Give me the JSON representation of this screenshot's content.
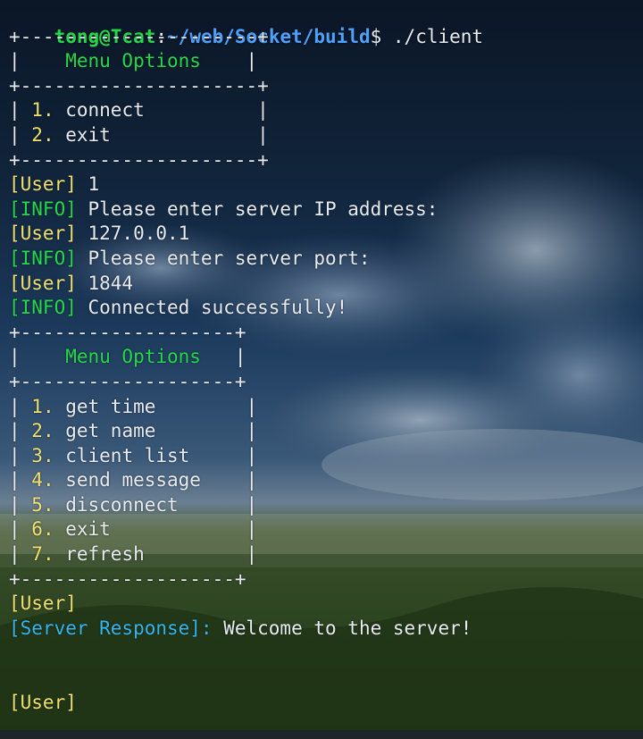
{
  "prompt": {
    "user_host": "tong@Tcat",
    "separator": ":",
    "path": "~/web/Socket/build",
    "symbol": "$",
    "command": " ./client"
  },
  "menu1": {
    "top_border": "+---------------------+",
    "title_left": "|    ",
    "title": "Menu Options",
    "title_right": "    |",
    "mid_border": "+---------------------+",
    "items": [
      {
        "num": " 1.",
        "label": " connect",
        "pad": "          |"
      },
      {
        "num": " 2.",
        "label": " exit",
        "pad": "             |"
      }
    ],
    "bottom_border": "+---------------------+"
  },
  "log1": [
    {
      "tag": "[User]",
      "text": " 1",
      "kind": "user"
    },
    {
      "tag": "[INFO]",
      "text": " Please enter server IP address:",
      "kind": "info"
    },
    {
      "tag": "[User]",
      "text": " 127.0.0.1",
      "kind": "user"
    },
    {
      "tag": "[INFO]",
      "text": " Please enter server port:",
      "kind": "info"
    },
    {
      "tag": "[User]",
      "text": " 1844",
      "kind": "user"
    },
    {
      "tag": "[INFO]",
      "text": " Connected successfully!",
      "kind": "info"
    }
  ],
  "menu2": {
    "top_border": "+-------------------+",
    "title_left": "|    ",
    "title": "Menu Options",
    "title_right": "   |",
    "mid_border": "+-------------------+",
    "items": [
      {
        "num": " 1.",
        "label": " get time",
        "pad": "        |"
      },
      {
        "num": " 2.",
        "label": " get name",
        "pad": "        |"
      },
      {
        "num": " 3.",
        "label": " client list",
        "pad": "     |"
      },
      {
        "num": " 4.",
        "label": " send message",
        "pad": "    |"
      },
      {
        "num": " 5.",
        "label": " disconnect",
        "pad": "      |"
      },
      {
        "num": " 6.",
        "label": " exit",
        "pad": "            |"
      },
      {
        "num": " 7.",
        "label": " refresh",
        "pad": "         |"
      }
    ],
    "bottom_border": "+-------------------+"
  },
  "log2": {
    "user_tag": "[User]",
    "server_tag": "[Server Response]:",
    "server_text": " Welcome to the server!",
    "final_user_tag": "[User]"
  },
  "colors": {
    "prompt_user": "#23d84a",
    "prompt_path": "#4ea1ff",
    "menu_title": "#23d84a",
    "menu_number": "#f0e070",
    "user_tag": "#f0e070",
    "info_tag": "#23d84a",
    "server_tag": "#34b5f0"
  }
}
